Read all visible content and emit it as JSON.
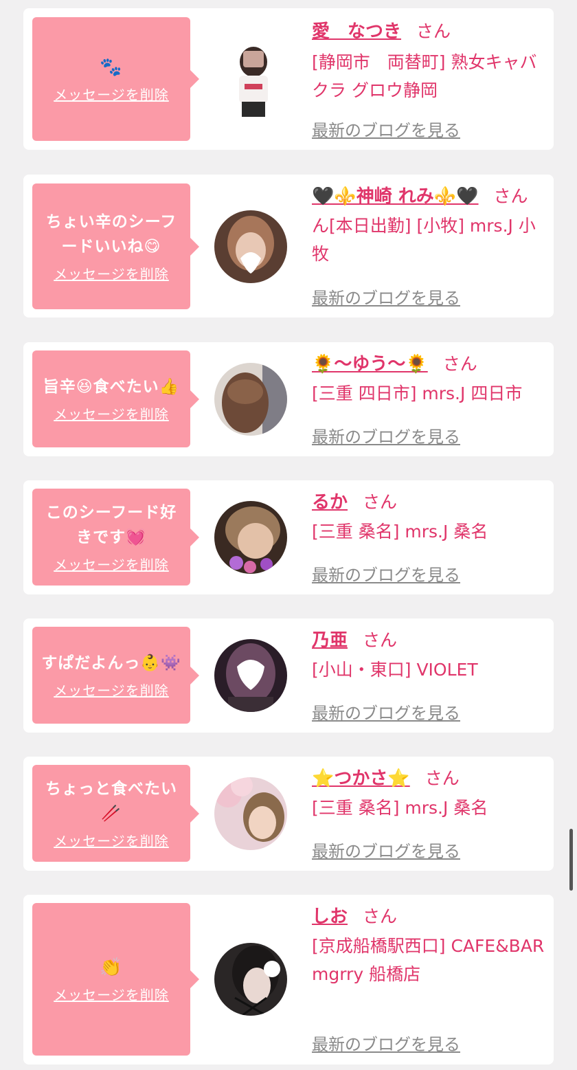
{
  "delete_label": "メッセージを削除",
  "blog_label": "最新のブログを見る",
  "san_label": "さん",
  "colors": {
    "bubble": "#fb9aa7",
    "accent": "#e0356a",
    "muted": "#8a8a8a"
  },
  "items": [
    {
      "message": "🐾",
      "name": "愛　なつき",
      "shop": "[静岡市　両替町] 熟女キャバクラ グロウ静岡",
      "avatar_icon": "photo-avatar"
    },
    {
      "message": "ちょい辛のシーフードいいね😋",
      "name": "🖤⚜️神崎 れみ⚜️🖤",
      "shop": "ん[本日出勤] [小牧] mrs.J 小牧",
      "avatar_icon": "photo-avatar"
    },
    {
      "message": "旨辛😆食べたい👍",
      "name": "🌻〜ゆう〜🌻",
      "shop": "[三重 四日市] mrs.J 四日市",
      "avatar_icon": "photo-avatar"
    },
    {
      "message": "このシーフード好きです💓",
      "name": "るか",
      "shop": "[三重 桑名] mrs.J 桑名",
      "avatar_icon": "photo-avatar"
    },
    {
      "message": "すぱだよんっ👶👾",
      "name": "乃亜",
      "shop": "[小山・東口] VIOLET",
      "avatar_icon": "photo-avatar"
    },
    {
      "message": "ちょっと食べたい🥢",
      "name": "⭐つかさ⭐",
      "shop": "[三重 桑名] mrs.J 桑名",
      "avatar_icon": "photo-avatar"
    },
    {
      "message": "👏",
      "name": "しお",
      "shop": "[京成船橋駅西口] CAFE&BAR mgrry 船橋店",
      "avatar_icon": "photo-avatar"
    }
  ]
}
